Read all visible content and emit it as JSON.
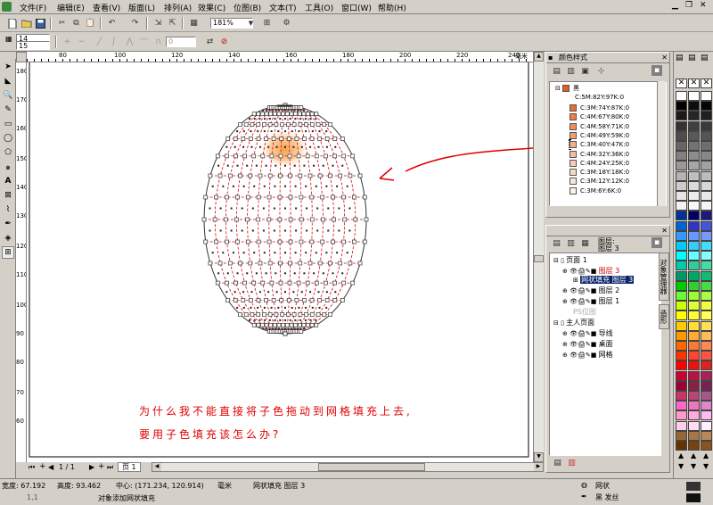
{
  "menu": {
    "items": [
      "文件(F)",
      "编辑(E)",
      "查看(V)",
      "版面(L)",
      "排列(A)",
      "效果(C)",
      "位图(B)",
      "文本(T)",
      "工具(O)",
      "窗口(W)",
      "帮助(H)"
    ]
  },
  "toolbar": {
    "zoom_value": "181%",
    "outline_width": "14",
    "outline_width2": "15",
    "spin_value": "0"
  },
  "rulers": {
    "h_ticks": [
      "80",
      "100",
      "120",
      "140",
      "160",
      "180",
      "200",
      "220",
      "240"
    ],
    "h_unit": "毫米",
    "v_ticks": [
      "180",
      "170",
      "160",
      "150",
      "140",
      "130",
      "120",
      "110",
      "100",
      "90",
      "80",
      "70",
      "60"
    ]
  },
  "canvas": {
    "question_line1": "为什么我不能直接将子色拖动到网格填充上去,",
    "question_line2": "要用子色填充该怎么办?",
    "accent_red": "#e00000",
    "mesh_line_color": "#e00000"
  },
  "color_styles": {
    "title": "颜色样式",
    "parent": {
      "name": "黑",
      "value": "C:5M:82Y:97K:0",
      "color": "#e85a1a"
    },
    "children": [
      {
        "value": "C:3M:74Y:87K:0",
        "color": "#eb6e2e"
      },
      {
        "value": "C:4M:67Y:80K:0",
        "color": "#ee7f45"
      },
      {
        "value": "C:4M:58Y:71K:0",
        "color": "#f08f58"
      },
      {
        "value": "C:4M:49Y:59K:0",
        "color": "#f3a072"
      },
      {
        "value": "C:3M:40Y:47K:0",
        "color": "#f5b08a"
      },
      {
        "value": "C:4M:32Y:36K:0",
        "color": "#f6bea0"
      },
      {
        "value": "C:4M:24Y:25K:0",
        "color": "#f8ccb6"
      },
      {
        "value": "C:3M:18Y:18K:0",
        "color": "#f9d8c8"
      },
      {
        "value": "C:3M:12Y:12K:0",
        "color": "#fbe4d8"
      },
      {
        "value": "C:3M:6Y:6K:0",
        "color": "#fdf1ea"
      }
    ]
  },
  "object_manager": {
    "layer_label": "图层:",
    "layer_current": "图层 3",
    "tree": [
      {
        "label": "页面 1",
        "level": 0
      },
      {
        "label": "图层 3",
        "level": 1,
        "color": "#cc0000"
      },
      {
        "label": "网状填充 图层 3",
        "level": 2,
        "selected": true
      },
      {
        "label": "图层 2",
        "level": 1
      },
      {
        "label": "图层 1",
        "level": 1
      },
      {
        "label": "PS位图",
        "level": 2,
        "dim": true
      },
      {
        "label": "主人页面",
        "level": 0
      },
      {
        "label": "导线",
        "level": 1
      },
      {
        "label": "桌面",
        "level": 1
      },
      {
        "label": "网格",
        "level": 1
      }
    ],
    "vtab1": "对象管理器",
    "vtab2": "造形"
  },
  "pages": {
    "indicator": "1 / 1",
    "tab": "页 1"
  },
  "status": {
    "width_label": "宽度: 67.192",
    "height_label": "高度: 93.462",
    "center_label": "中心: (171.234, 120.914)",
    "unit": "毫米",
    "object_info": "网状填充 图层 3",
    "hint": "对象添加网状填充",
    "fill_label": "网状",
    "outline_label": "黑 发丝",
    "coords": "1,1"
  }
}
